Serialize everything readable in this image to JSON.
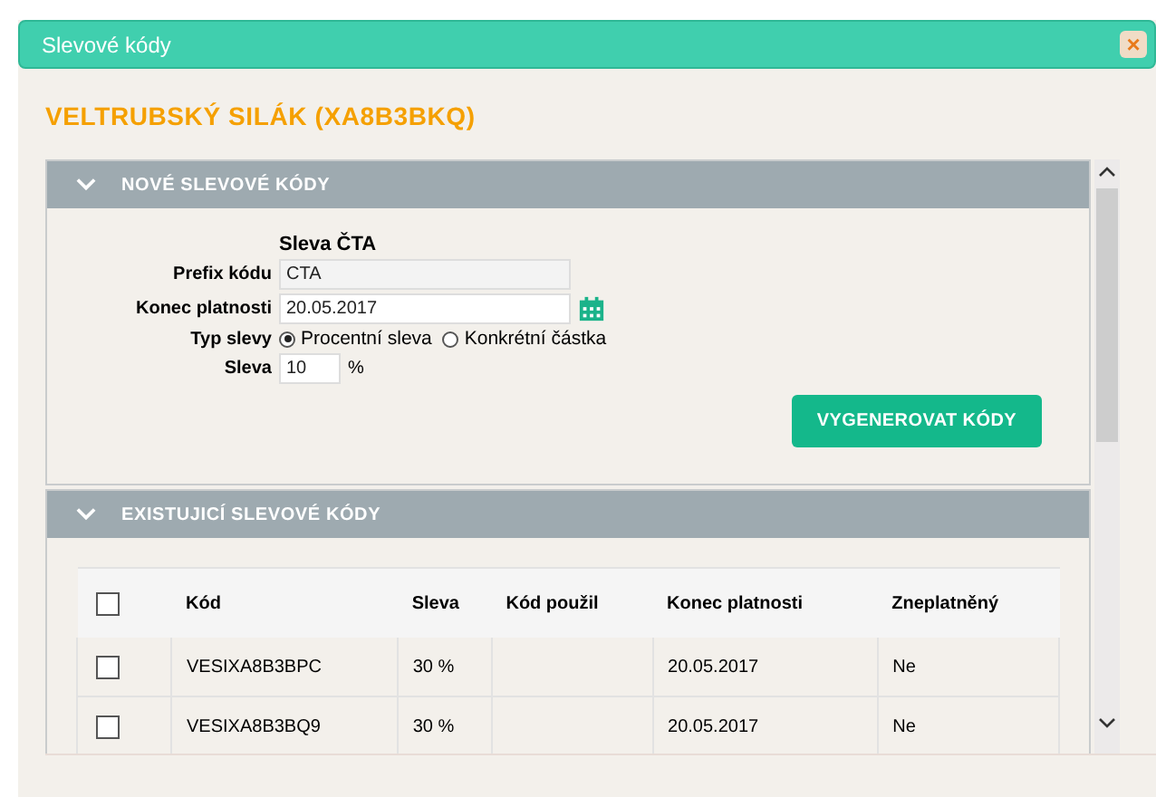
{
  "window": {
    "title": "Slevové kódy",
    "close_icon": "×"
  },
  "heading": "VELTRUBSKÝ SILÁK (XA8B3BKQ)",
  "new_codes": {
    "title": "NOVÉ SLEVOVÉ KÓDY",
    "expanded": true,
    "name": "Sleva ČTA",
    "fields": [
      {
        "kind": "text",
        "label": "Prefix kódu",
        "value": "CTA",
        "disabled": true
      },
      {
        "kind": "date",
        "label": "Konec platnosti",
        "value": "20.05.2017"
      },
      {
        "kind": "radio",
        "label": "Typ slevy",
        "options": [
          {
            "label": "Procentní sleva",
            "selected": true
          },
          {
            "label": "Konkrétní částka",
            "selected": false
          }
        ]
      },
      {
        "kind": "number",
        "label": "Sleva",
        "value": "10",
        "unit": "%"
      }
    ],
    "button": "VYGENEROVAT KÓDY"
  },
  "existing_codes": {
    "title": "EXISTUJICÍ SLEVOVÉ KÓDY",
    "expanded": true,
    "table": {
      "columns": [
        "Kód",
        "Sleva",
        "Kód použil",
        "Konec platnosti",
        "Zneplatněný"
      ],
      "all_checked": false,
      "rows": [
        {
          "checked": false,
          "cells": [
            "VESIXA8B3BPC",
            "30 %",
            "",
            "20.05.2017",
            "Ne"
          ]
        },
        {
          "checked": false,
          "cells": [
            "VESIXA8B3BQ9",
            "30 %",
            "",
            "20.05.2017",
            "Ne"
          ]
        }
      ]
    }
  }
}
